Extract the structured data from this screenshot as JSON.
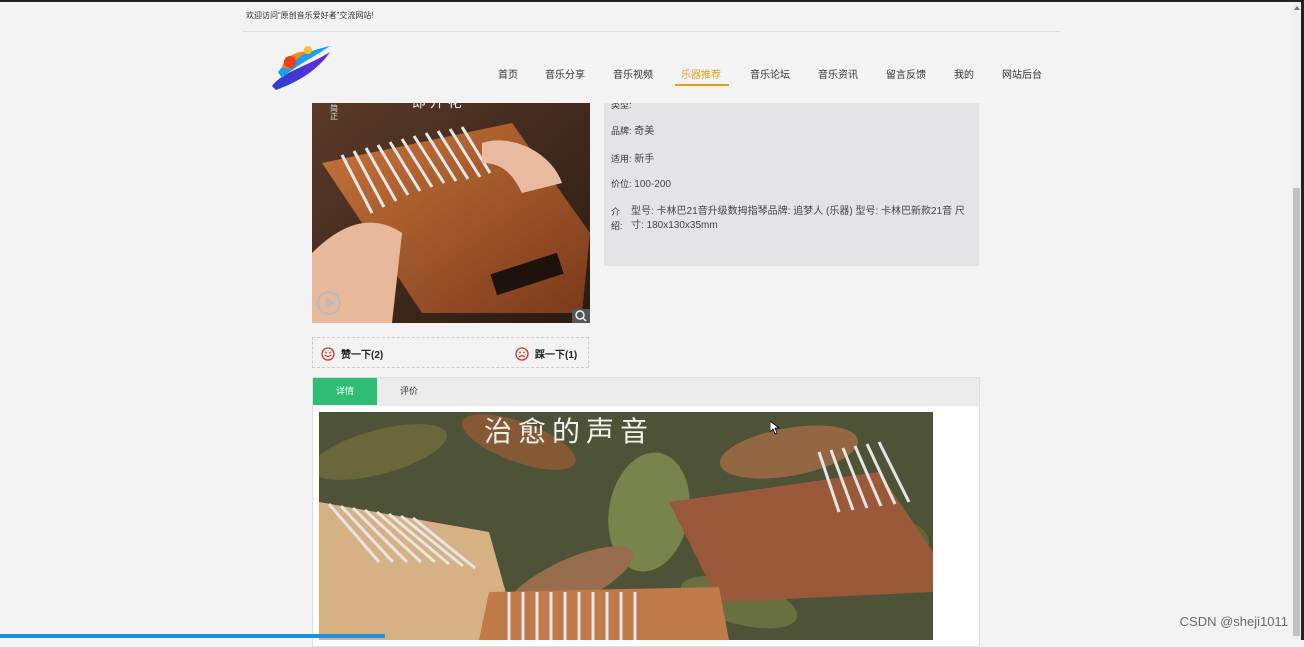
{
  "header": {
    "welcome": "欢迎访问“原创音乐爱好者”交流网站!"
  },
  "nav": {
    "items": [
      {
        "label": "首页",
        "active": false
      },
      {
        "label": "音乐分享",
        "active": false
      },
      {
        "label": "音乐视频",
        "active": false
      },
      {
        "label": "乐器推荐",
        "active": true
      },
      {
        "label": "音乐论坛",
        "active": false
      },
      {
        "label": "音乐资讯",
        "active": false
      },
      {
        "label": "留言反馈",
        "active": false
      },
      {
        "label": "我的",
        "active": false
      },
      {
        "label": "网站后台",
        "active": false
      }
    ],
    "active_color": "#e0a21c"
  },
  "product": {
    "image_icon": "kalimba-photo",
    "fields": [
      {
        "label": "品牌:",
        "value": "奇美"
      },
      {
        "label": "适用:",
        "value": "新手"
      },
      {
        "label": "价位:",
        "value": "100-200"
      }
    ],
    "intro_label": "介绍:",
    "intro_value": "型号: 卡林巴21音升级数拇指琴品牌: 追梦人 (乐器) 型号: 卡林巴新款21音 尺寸: 180x130x35mm"
  },
  "votes": {
    "like_label": "赞一下(2)",
    "dislike_label": "踩一下(1)",
    "icon_color": "#d0302a"
  },
  "tabs": [
    {
      "label": "详情",
      "active": true
    },
    {
      "label": "评价",
      "active": false
    }
  ],
  "detail": {
    "banner_text": "治愈的声音"
  },
  "watermark": "CSDN @sheji1011",
  "colors": {
    "tab_active": "#2fbd74",
    "panel_bg": "#e4e4e6",
    "progress": "#1e8fe0"
  }
}
